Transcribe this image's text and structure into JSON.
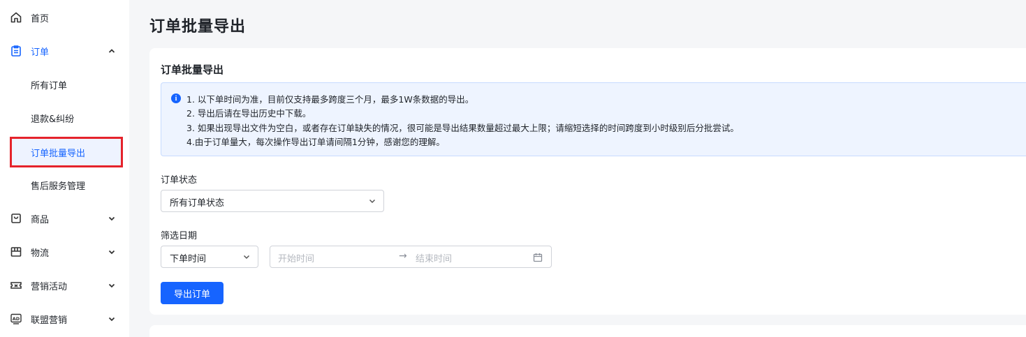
{
  "sidebar": {
    "home": {
      "label": "首页",
      "icon": "home-icon"
    },
    "orders": {
      "label": "订单",
      "icon": "clipboard-icon",
      "expanded": true
    },
    "order_sub": [
      "所有订单",
      "退款&纠纷",
      "订单批量导出",
      "售后服务管理"
    ],
    "active_sub": "订单批量导出",
    "products": {
      "label": "商品",
      "icon": "shopping-bag-icon"
    },
    "logistics": {
      "label": "物流",
      "icon": "package-icon"
    },
    "marketing": {
      "label": "营销活动",
      "icon": "ticket-icon"
    },
    "affiliate": {
      "label": "联盟营销",
      "icon": "ad-icon"
    }
  },
  "page": {
    "title": "订单批量导出"
  },
  "card": {
    "title": "订单批量导出",
    "notice": [
      "1. 以下单时间为准，目前仅支持最多跨度三个月，最多1W条数据的导出。",
      "2. 导出后请在导出历史中下载。",
      "3. 如果出现导出文件为空白，或者存在订单缺失的情况，很可能是导出结果数量超过最大上限；请缩短选择的时间跨度到小时级别后分批尝试。",
      "4.由于订单量大，每次操作导出订单请间隔1分钟，感谢您的理解。"
    ],
    "status_label": "订单状态",
    "status_value": "所有订单状态",
    "date_label": "筛选日期",
    "date_type_value": "下单时间",
    "start_placeholder": "开始时间",
    "end_placeholder": "结束时间",
    "range_separator": "→",
    "export_button": "导出订单"
  },
  "colors": {
    "accent": "#1664ff",
    "highlight_border": "#e5232b",
    "notice_bg": "#eef4ff"
  }
}
